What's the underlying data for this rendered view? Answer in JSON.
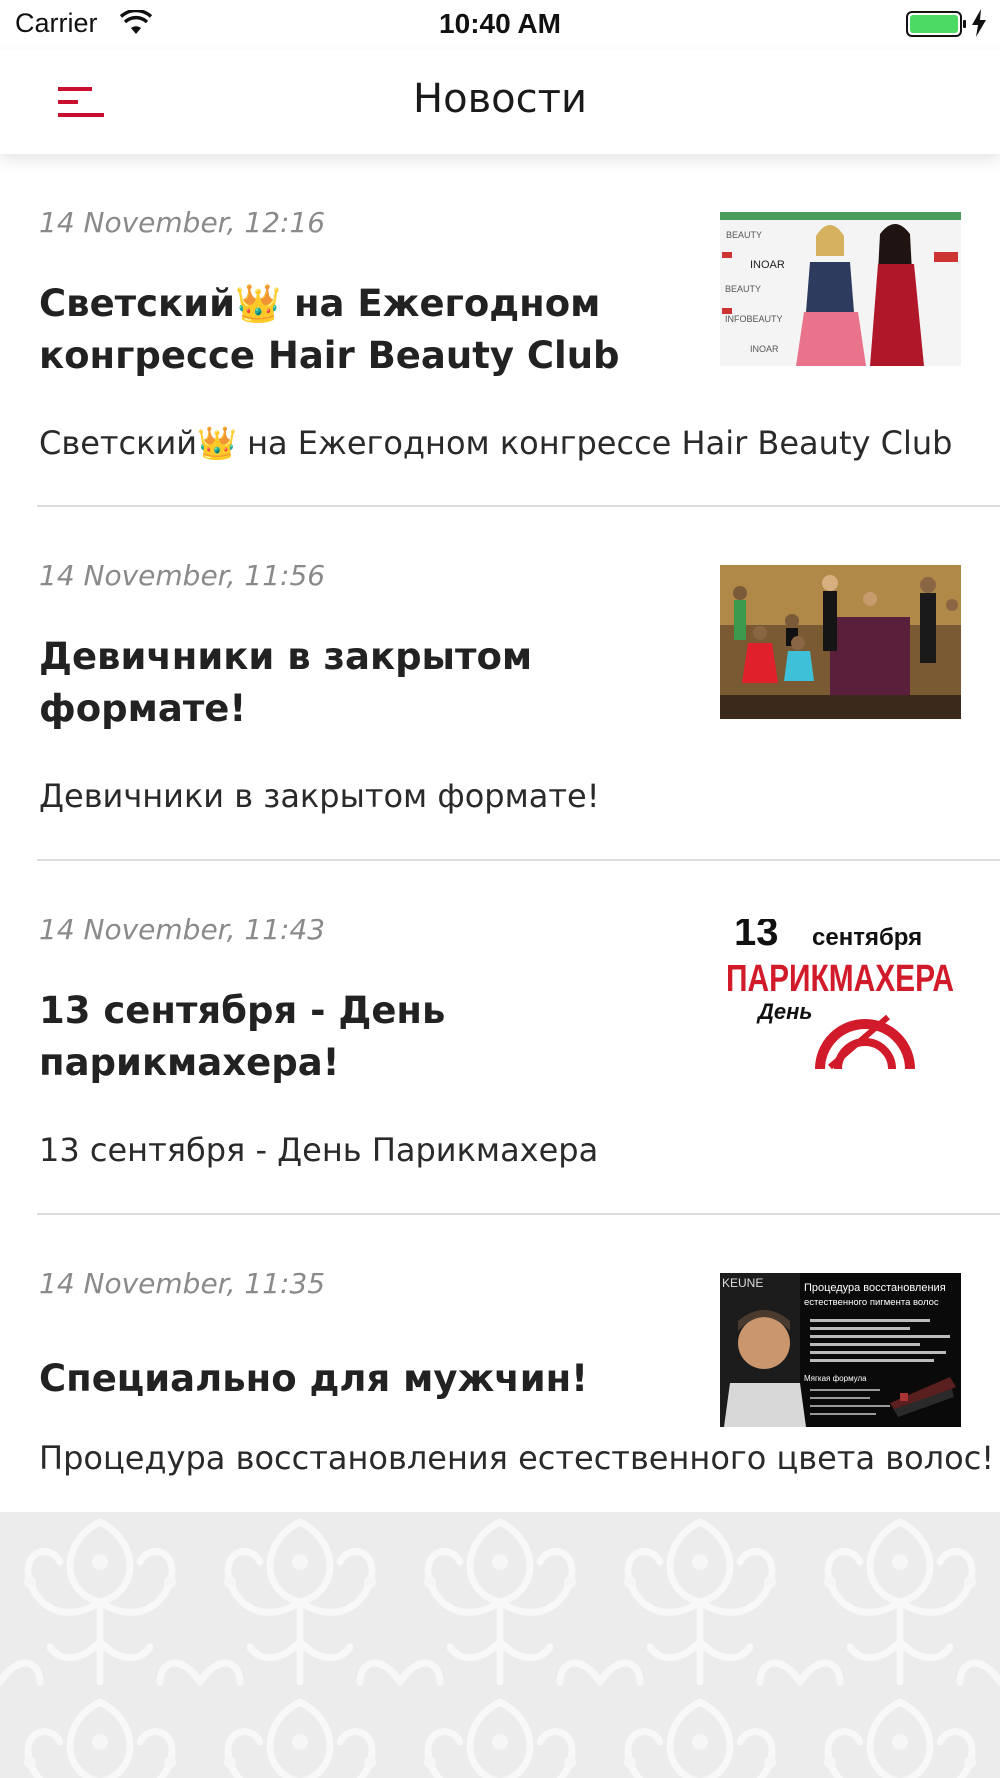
{
  "status_bar": {
    "carrier": "Carrier",
    "time": "10:40 AM",
    "battery_color": "#4cd964"
  },
  "header": {
    "title": "Новости",
    "accent_color": "#c8102e"
  },
  "news": [
    {
      "date": "14 November, 12:16",
      "title": "Светский👑 на Ежегодном конгрессе Hair Beauty Club",
      "summary": "Светский👑 на Ежегодном конгрессе Hair Beauty Club",
      "thumb_texts": [
        "INOAR",
        "BEAUTY"
      ]
    },
    {
      "date": "14 November, 11:56",
      "title": "Девичники в закрытом формате!",
      "summary": "Девичники в закрытом формате!"
    },
    {
      "date": "14 November, 11:43",
      "title": "13 сентября - День парикмахера!",
      "summary": "13 сентября - День Парикмахера",
      "thumb_texts": [
        "13",
        "сентября",
        "ПАРИКМАХЕРА",
        "День"
      ]
    },
    {
      "date": "14 November, 11:35",
      "title": "Специально для мужчин!",
      "summary": "Процедура восстановления естественного цвета волос!",
      "thumb_texts": [
        "KEUNE",
        "Процедура восстановления",
        "естественного пигмента волос",
        "Мягкая формула"
      ]
    }
  ]
}
